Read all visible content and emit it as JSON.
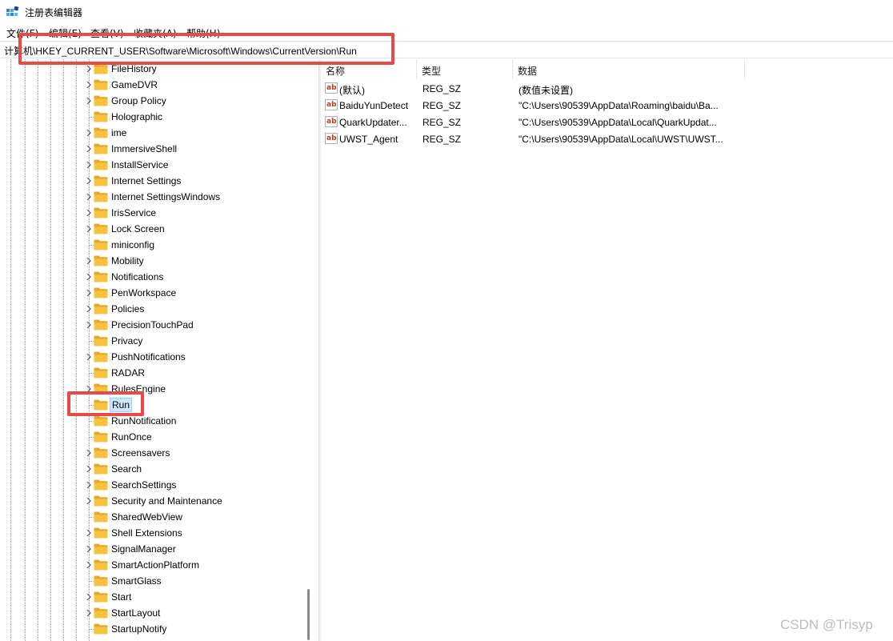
{
  "window": {
    "title": "注册表编辑器"
  },
  "menu": [
    "文件(F)",
    "编辑(E)",
    "查看(V)",
    "收藏夹(A)",
    "帮助(H)"
  ],
  "address": {
    "path": "计算机\\HKEY_CURRENT_USER\\Software\\Microsoft\\Windows\\CurrentVersion\\Run"
  },
  "tree": {
    "selected": "Run",
    "items": [
      {
        "label": "FileHistory",
        "expandable": true
      },
      {
        "label": "GameDVR",
        "expandable": true
      },
      {
        "label": "Group Policy",
        "expandable": true
      },
      {
        "label": "Holographic",
        "expandable": false
      },
      {
        "label": "ime",
        "expandable": true
      },
      {
        "label": "ImmersiveShell",
        "expandable": true
      },
      {
        "label": "InstallService",
        "expandable": true
      },
      {
        "label": "Internet Settings",
        "expandable": true
      },
      {
        "label": "Internet SettingsWindows",
        "expandable": true
      },
      {
        "label": "IrisService",
        "expandable": true
      },
      {
        "label": "Lock Screen",
        "expandable": true
      },
      {
        "label": "miniconfig",
        "expandable": false
      },
      {
        "label": "Mobility",
        "expandable": true
      },
      {
        "label": "Notifications",
        "expandable": true
      },
      {
        "label": "PenWorkspace",
        "expandable": true
      },
      {
        "label": "Policies",
        "expandable": true
      },
      {
        "label": "PrecisionTouchPad",
        "expandable": true
      },
      {
        "label": "Privacy",
        "expandable": false
      },
      {
        "label": "PushNotifications",
        "expandable": true
      },
      {
        "label": "RADAR",
        "expandable": false
      },
      {
        "label": "RulesEngine",
        "expandable": true
      },
      {
        "label": "Run",
        "expandable": false
      },
      {
        "label": "RunNotification",
        "expandable": false
      },
      {
        "label": "RunOnce",
        "expandable": false
      },
      {
        "label": "Screensavers",
        "expandable": true
      },
      {
        "label": "Search",
        "expandable": true
      },
      {
        "label": "SearchSettings",
        "expandable": true
      },
      {
        "label": "Security and Maintenance",
        "expandable": true
      },
      {
        "label": "SharedWebView",
        "expandable": false
      },
      {
        "label": "Shell Extensions",
        "expandable": true
      },
      {
        "label": "SignalManager",
        "expandable": true
      },
      {
        "label": "SmartActionPlatform",
        "expandable": true
      },
      {
        "label": "SmartGlass",
        "expandable": false
      },
      {
        "label": "Start",
        "expandable": true
      },
      {
        "label": "StartLayout",
        "expandable": true
      },
      {
        "label": "StartupNotify",
        "expandable": false
      }
    ]
  },
  "list": {
    "columns": [
      "名称",
      "类型",
      "数据"
    ],
    "rows": [
      {
        "name": "(默认)",
        "type": "REG_SZ",
        "data": "(数值未设置)"
      },
      {
        "name": "BaiduYunDetect",
        "type": "REG_SZ",
        "data": "\"C:\\Users\\90539\\AppData\\Roaming\\baidu\\Ba..."
      },
      {
        "name": "QuarkUpdater...",
        "type": "REG_SZ",
        "data": "\"C:\\Users\\90539\\AppData\\Local\\QuarkUpdat..."
      },
      {
        "name": "UWST_Agent",
        "type": "REG_SZ",
        "data": "\"C:\\Users\\90539\\AppData\\Local\\UWST\\UWST..."
      }
    ]
  },
  "value_icon": "string-value-icon",
  "colors": {
    "highlight": "#e84a4a",
    "selection": "#cce8ff",
    "folder": "#f5c342"
  },
  "watermark": "CSDN @Trisyp"
}
